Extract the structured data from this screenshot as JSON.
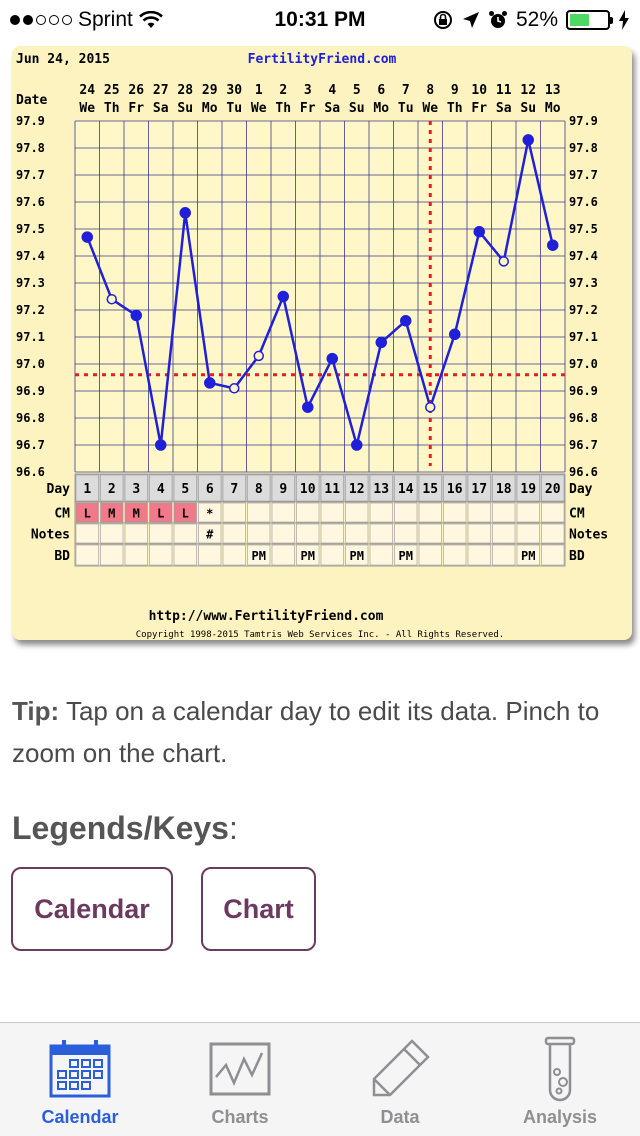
{
  "status_bar": {
    "carrier": "Sprint",
    "time": "10:31 PM",
    "battery_percent": "52%",
    "battery_level": 0.52,
    "signal_bars_filled": 2,
    "signal_bars_total": 5
  },
  "chart_header": {
    "date": "Jun 24, 2015",
    "site": "FertilityFriend.com",
    "url": "http://www.FertilityFriend.com",
    "copyright": "Copyright 1998-2015 Tamtris Web Services Inc. - All Rights Reserved."
  },
  "chart_labels": {
    "date": "Date",
    "day": "Day",
    "cm": "CM",
    "notes": "Notes",
    "bd": "BD"
  },
  "chart_data": {
    "type": "line",
    "x_dates": [
      "24",
      "25",
      "26",
      "27",
      "28",
      "29",
      "30",
      "1",
      "2",
      "3",
      "4",
      "5",
      "6",
      "7",
      "8",
      "9",
      "10",
      "11",
      "12",
      "13"
    ],
    "x_weekdays": [
      "We",
      "Th",
      "Fr",
      "Sa",
      "Su",
      "Mo",
      "Tu",
      "We",
      "Th",
      "Fr",
      "Sa",
      "Su",
      "Mo",
      "Tu",
      "We",
      "Th",
      "Fr",
      "Sa",
      "Su",
      "Mo"
    ],
    "cycle_days": [
      "1",
      "2",
      "3",
      "4",
      "5",
      "6",
      "7",
      "8",
      "9",
      "10",
      "11",
      "12",
      "13",
      "14",
      "15",
      "16",
      "17",
      "18",
      "19",
      "20"
    ],
    "y_ticks": [
      "97.9",
      "97.8",
      "97.7",
      "97.6",
      "97.5",
      "97.4",
      "97.3",
      "97.2",
      "97.1",
      "97.0",
      "96.9",
      "96.8",
      "96.7",
      "96.6"
    ],
    "ylim": [
      96.6,
      97.9
    ],
    "temperatures": [
      97.47,
      97.24,
      97.18,
      96.7,
      97.56,
      96.93,
      96.91,
      97.03,
      97.25,
      96.84,
      97.02,
      96.7,
      97.08,
      97.16,
      96.84,
      97.11,
      97.49,
      97.38,
      97.83,
      97.44
    ],
    "open_markers": [
      1,
      6,
      7,
      14,
      17
    ],
    "coverline": 96.96,
    "ovulation_day_index": 14,
    "cm": [
      "L",
      "M",
      "M",
      "L",
      "L",
      "*",
      "",
      "",
      "",
      "",
      "",
      "",
      "",
      "",
      "",
      "",
      "",
      "",
      "",
      ""
    ],
    "notes": [
      "",
      "",
      "",
      "",
      "",
      "#",
      "",
      "",
      "",
      "",
      "",
      "",
      "",
      "",
      "",
      "",
      "",
      "",
      "",
      ""
    ],
    "bd": [
      "",
      "",
      "",
      "",
      "",
      "",
      "",
      "PM",
      "",
      "PM",
      "",
      "PM",
      "",
      "PM",
      "",
      "",
      "",
      "",
      "PM",
      ""
    ],
    "colors": {
      "line": "#2020d8",
      "coverline": "#e02020",
      "grid": "#3a3a8a",
      "background": "#fcf3c0",
      "menstruation": "#f07a8a"
    }
  },
  "tip": {
    "label": "Tip:",
    "text": "Tap on a calendar day to edit its data. Pinch to zoom on the chart."
  },
  "legends": {
    "title": "Legends/Keys",
    "colon": ":",
    "calendar_label": "Calendar",
    "chart_label": "Chart"
  },
  "tabs": [
    {
      "label": "Calendar",
      "icon": "calendar-icon",
      "active": true
    },
    {
      "label": "Charts",
      "icon": "chart-icon",
      "active": false
    },
    {
      "label": "Data",
      "icon": "pencil-icon",
      "active": false
    },
    {
      "label": "Analysis",
      "icon": "test-tube-icon",
      "active": false
    }
  ]
}
